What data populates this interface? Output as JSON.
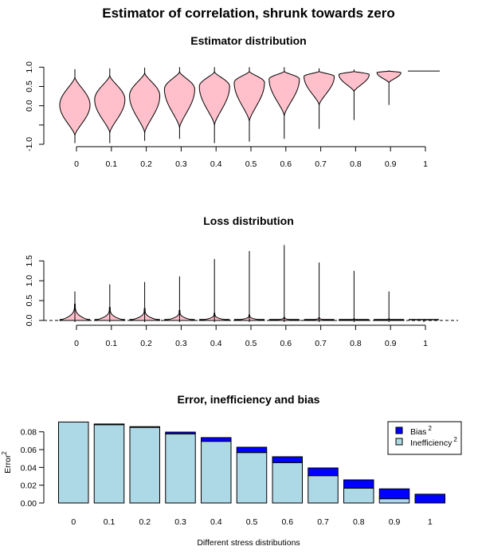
{
  "title": "Estimator of correlation, shrunk towards zero",
  "chart_data": [
    {
      "type": "violin",
      "title": "Estimator distribution",
      "categories": [
        "0",
        "0.1",
        "0.2",
        "0.3",
        "0.4",
        "0.5",
        "0.6",
        "0.7",
        "0.8",
        "0.9",
        "1"
      ],
      "ylim": [
        -1,
        1
      ],
      "yticks": [
        -1,
        -0.5,
        0,
        0.5,
        1
      ],
      "ytick_labels": [
        "-1.0",
        "",
        "0.0",
        "0.5",
        "1.0"
      ],
      "fill": "#ffc0cb",
      "distributions": [
        {
          "max": 0.95,
          "body_top": 0.74,
          "mode": 0.02,
          "body_bottom": -0.77,
          "min": -0.97
        },
        {
          "max": 0.97,
          "body_top": 0.78,
          "mode": 0.16,
          "body_bottom": -0.7,
          "min": -0.97
        },
        {
          "max": 0.99,
          "body_top": 0.85,
          "mode": 0.26,
          "body_bottom": -0.7,
          "min": -0.91
        },
        {
          "max": 1.0,
          "body_top": 0.88,
          "mode": 0.43,
          "body_bottom": -0.57,
          "min": -0.86
        },
        {
          "max": 1.0,
          "body_top": 0.88,
          "mode": 0.5,
          "body_bottom": -0.5,
          "min": -0.97
        },
        {
          "max": 1.0,
          "body_top": 0.89,
          "mode": 0.6,
          "body_bottom": -0.4,
          "min": -0.93
        },
        {
          "max": 1.0,
          "body_top": 0.89,
          "mode": 0.69,
          "body_bottom": -0.26,
          "min": -0.86
        },
        {
          "max": 0.97,
          "body_top": 0.89,
          "mode": 0.76,
          "body_bottom": 0.02,
          "min": -0.6
        },
        {
          "max": 0.94,
          "body_top": 0.89,
          "mode": 0.81,
          "body_bottom": 0.37,
          "min": -0.37
        },
        {
          "max": 0.92,
          "body_top": 0.9,
          "mode": 0.86,
          "body_bottom": 0.6,
          "min": 0.02
        },
        {
          "max": 0.9,
          "body_top": 0.9,
          "mode": 0.9,
          "body_bottom": 0.9,
          "min": 0.9
        }
      ]
    },
    {
      "type": "violin",
      "title": "Loss distribution",
      "categories": [
        "0",
        "0.1",
        "0.2",
        "0.3",
        "0.4",
        "0.5",
        "0.6",
        "0.7",
        "0.8",
        "0.9",
        "1"
      ],
      "ylim": [
        0,
        1.9
      ],
      "yticks": [
        0,
        0.5,
        1,
        1.5
      ],
      "ytick_labels": [
        "0.0",
        "0.5",
        "1.0",
        "1.5"
      ],
      "reference_line": 0,
      "fill": "#ffc0cb",
      "distributions": [
        {
          "max": 0.73,
          "body_top": 0.41
        },
        {
          "max": 0.91,
          "body_top": 0.33
        },
        {
          "max": 0.97,
          "body_top": 0.3
        },
        {
          "max": 1.11,
          "body_top": 0.25
        },
        {
          "max": 1.55,
          "body_top": 0.18
        },
        {
          "max": 1.75,
          "body_top": 0.14
        },
        {
          "max": 1.9,
          "body_top": 0.08
        },
        {
          "max": 1.46,
          "body_top": 0.07
        },
        {
          "max": 1.25,
          "body_top": 0.04
        },
        {
          "max": 0.73,
          "body_top": 0.04
        },
        {
          "max": 0.01,
          "body_top": 0.0
        }
      ]
    },
    {
      "type": "bar",
      "stacked": true,
      "title": "Error, inefficiency and bias",
      "xlabel": "Different stress distributions",
      "ylabel": "Error",
      "ylabel_sup": "2",
      "categories": [
        "0",
        "0.1",
        "0.2",
        "0.3",
        "0.4",
        "0.5",
        "0.6",
        "0.7",
        "0.8",
        "0.9",
        "1"
      ],
      "ylim": [
        0,
        0.09
      ],
      "yticks": [
        "0.00",
        "0.02",
        "0.04",
        "0.06",
        "0.08"
      ],
      "legend_position": "top-right",
      "series": [
        {
          "name": "Inefficiency",
          "sup": "2",
          "color": "#add8e6",
          "values": [
            0.091,
            0.088,
            0.085,
            0.0777,
            0.0693,
            0.0567,
            0.0454,
            0.0307,
            0.0167,
            0.0048,
            0
          ]
        },
        {
          "name": "Bias",
          "sup": "2",
          "color": "#0000ff",
          "values": [
            0,
            0.0008,
            0.0008,
            0.002,
            0.0042,
            0.006,
            0.0066,
            0.0087,
            0.0093,
            0.0111,
            0.0099
          ]
        }
      ]
    }
  ]
}
